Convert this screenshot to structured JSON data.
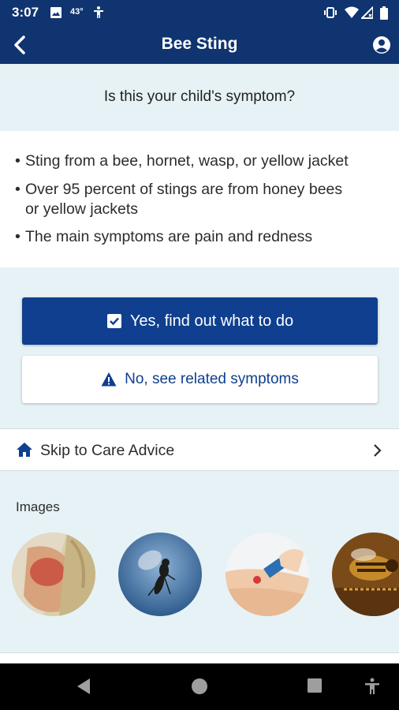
{
  "status_bar": {
    "time": "3:07",
    "temperature": "43°",
    "icons": [
      "gallery-icon",
      "temperature-icon",
      "accessibility-icon",
      "vibrate-icon",
      "wifi-icon",
      "signal-icon",
      "battery-icon"
    ]
  },
  "app_bar": {
    "title": "Bee Sting",
    "back_icon": "back-arrow-icon",
    "profile_icon": "account-circle-icon"
  },
  "question": "Is this your child's symptom?",
  "bullets": [
    "Sting from a bee, hornet, wasp, or yellow jacket",
    "Over 95 percent of stings are from honey bees\nor yellow jackets",
    "The main symptoms are pain and redness"
  ],
  "bullet_marker": "•",
  "actions": {
    "yes_label": "Yes, find out what to do",
    "no_label": "No, see related symptoms"
  },
  "skip": {
    "label": "Skip to Care Advice"
  },
  "images": {
    "heading": "Images",
    "items": [
      "sting-redness-photo",
      "wasp-photo",
      "stinger-scrape-illustration",
      "honeybee-photo"
    ]
  },
  "colors": {
    "primary": "#0f3470",
    "button": "#0f3f8e",
    "background": "#e6f2f5"
  }
}
